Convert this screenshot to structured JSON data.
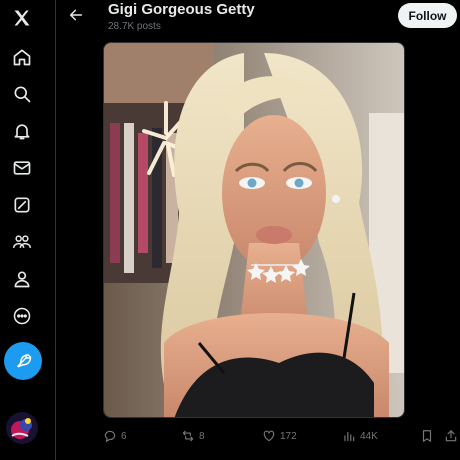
{
  "header": {
    "title": "Gigi Gorgeous Getty",
    "post_count": "28.7K posts",
    "follow_label": "Follow"
  },
  "nav": {
    "items": [
      "x-logo-icon",
      "home-icon",
      "search-icon",
      "notifications-icon",
      "messages-icon",
      "grok-icon",
      "communities-icon",
      "profile-icon",
      "more-icon"
    ],
    "compose_icon": "compose-feather-icon"
  },
  "actions": {
    "replies": "6",
    "reposts": "8",
    "likes": "172",
    "views": "44K"
  },
  "colors": {
    "background": "#000000",
    "accent": "#1d9bf0",
    "muted_text": "#71767b",
    "follow_button": "#eff3f4"
  }
}
